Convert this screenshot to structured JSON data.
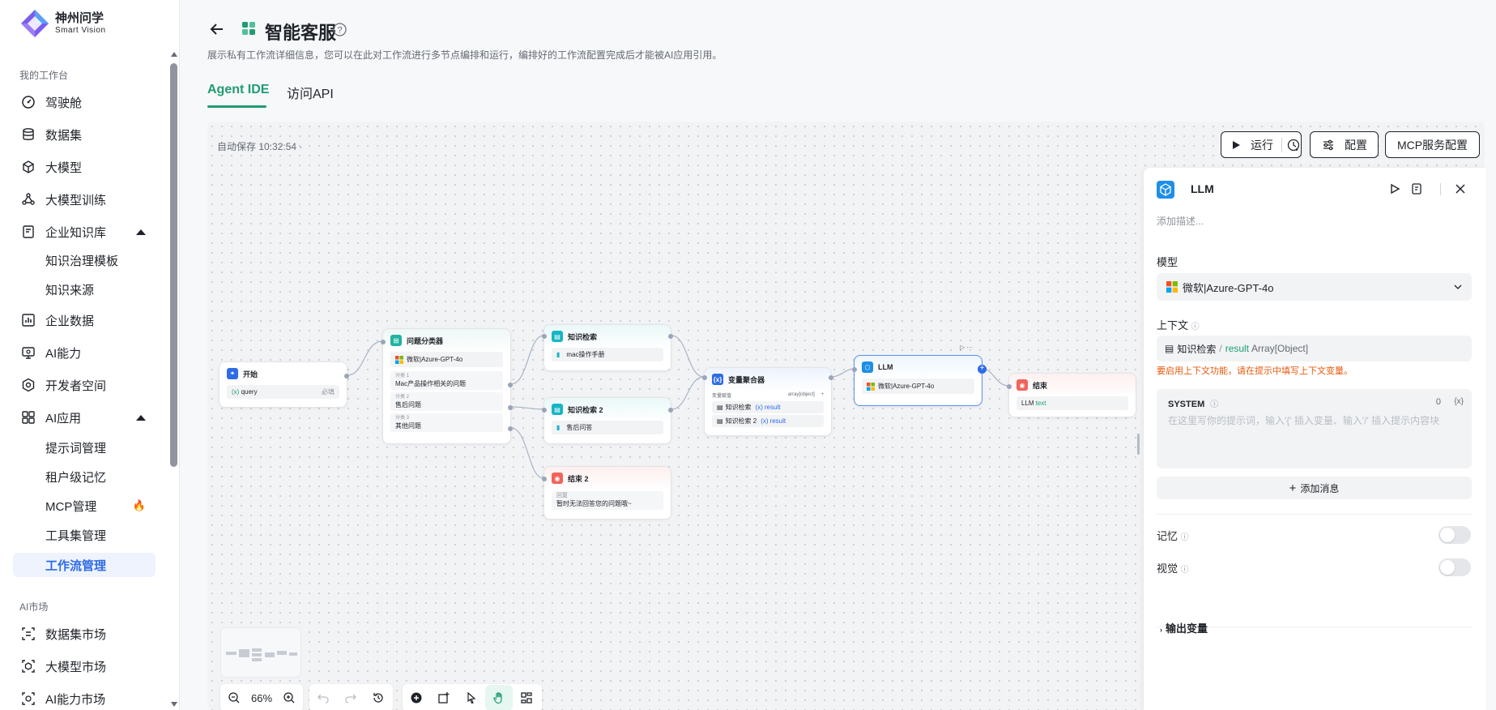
{
  "brand": {
    "name": "神州问学",
    "sub": "Smart Vision"
  },
  "sidebar": {
    "section_workspace": "我的工作台",
    "items": [
      {
        "label": "驾驶舱",
        "icon": "dashboard-icon"
      },
      {
        "label": "数据集",
        "icon": "database-icon"
      },
      {
        "label": "大模型",
        "icon": "cube-icon"
      },
      {
        "label": "大模型训练",
        "icon": "training-icon"
      },
      {
        "label": "企业知识库",
        "icon": "knowledge-icon"
      },
      {
        "label": "知识治理模板"
      },
      {
        "label": "知识来源"
      },
      {
        "label": "企业数据",
        "icon": "chart-icon"
      },
      {
        "label": "AI能力",
        "icon": "monitor-icon"
      },
      {
        "label": "开发者空间",
        "icon": "dev-icon"
      },
      {
        "label": "AI应用",
        "icon": "apps-icon"
      },
      {
        "label": "提示词管理"
      },
      {
        "label": "租户级记忆"
      },
      {
        "label": "MCP管理"
      },
      {
        "label": "工具集管理"
      },
      {
        "label": "工作流管理"
      }
    ],
    "section_market": "AI市场",
    "market_items": [
      {
        "label": "数据集市场"
      },
      {
        "label": "大模型市场"
      },
      {
        "label": "AI能力市场"
      }
    ]
  },
  "header": {
    "title": "智能客服",
    "description": "展示私有工作流详细信息，您可以在此对工作流进行多节点编排和运行，编排好的工作流配置完成后才能被AI应用引用。",
    "tabs": [
      {
        "label": "Agent IDE"
      },
      {
        "label": "访问API"
      }
    ]
  },
  "canvas": {
    "autosave": "自动保存 10:32:54 ·",
    "buttons": {
      "run": "运行",
      "config": "配置",
      "mcp": "MCP服务配置"
    },
    "zoom": "66%"
  },
  "nodes": {
    "start": {
      "title": "开始",
      "var": "query",
      "required": "必填"
    },
    "classifier": {
      "title": "问题分类器",
      "model": "微软|Azure-GPT-4o",
      "classes": [
        {
          "label": "分类 1",
          "value": "Mac产品操作相关的问题"
        },
        {
          "label": "分类 2",
          "value": "售后问题"
        },
        {
          "label": "分类 3",
          "value": "其他问题"
        }
      ]
    },
    "kb1": {
      "title": "知识检索",
      "doc": "mac操作手册"
    },
    "kb2": {
      "title": "知识检索 2",
      "doc": "售后问答"
    },
    "end2": {
      "title": "结束 2",
      "label": "回复",
      "value": "暂时无法回答您的问题哦~"
    },
    "aggregator": {
      "title": "变量聚合器",
      "var_label": "变量赋值",
      "var_type": "array[object]",
      "rows": [
        {
          "src": "知识检索",
          "var": "result"
        },
        {
          "src": "知识检索 2",
          "var": "result"
        }
      ]
    },
    "llm": {
      "title": "LLM",
      "model": "微软|Azure-GPT-4o"
    },
    "end": {
      "title": "结束",
      "output_prefix": "LLM",
      "output_var": "text"
    }
  },
  "panel": {
    "title": "LLM",
    "desc_placeholder": "添加描述...",
    "model_label": "模型",
    "model_value": "微软|Azure-GPT-4o",
    "context_label": "上下文",
    "context_src": "知识检索",
    "context_var": "result",
    "context_type": "Array[Object]",
    "context_warning": "要启用上下文功能，请在提示中填写上下文变量。",
    "system_label": "SYSTEM",
    "system_count": "0",
    "system_placeholder": "在这里写你的提示词，输入'{' 插入变量、输入'/' 插入提示内容块",
    "add_message": "添加消息",
    "memory_label": "记忆",
    "vision_label": "视觉",
    "output_vars": "输出变量"
  },
  "colors": {
    "accent_green": "#1f9d71",
    "brand_blue": "#2e6be6",
    "warning": "#e8590c"
  }
}
